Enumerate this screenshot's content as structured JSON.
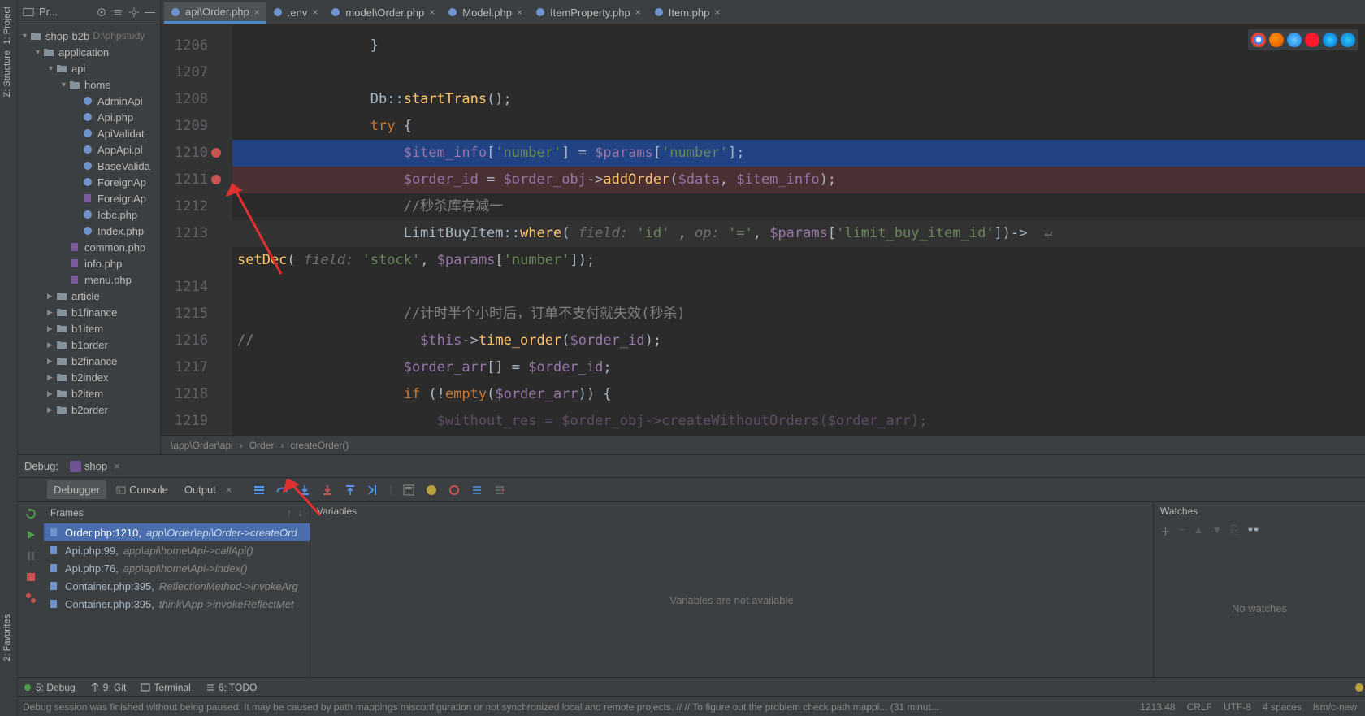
{
  "leftstrip": {
    "items": [
      "1: Project",
      "Z: Structure",
      "2: Favorites"
    ]
  },
  "project": {
    "head_label": "Pr...",
    "root": {
      "name": "shop-b2b",
      "path": "D:\\phpstudy"
    },
    "tree": [
      {
        "d": 0,
        "a": "o",
        "ic": "fd",
        "txt": "shop-b2b",
        "suffix": "D:\\phpstudy"
      },
      {
        "d": 1,
        "a": "o",
        "ic": "fd",
        "txt": "application"
      },
      {
        "d": 2,
        "a": "o",
        "ic": "fd",
        "txt": "api"
      },
      {
        "d": 3,
        "a": "o",
        "ic": "fd",
        "txt": "home"
      },
      {
        "d": 4,
        "a": "n",
        "ic": "php",
        "txt": "AdminApi"
      },
      {
        "d": 4,
        "a": "n",
        "ic": "php",
        "txt": "Api.php"
      },
      {
        "d": 4,
        "a": "n",
        "ic": "php",
        "txt": "ApiValidat"
      },
      {
        "d": 4,
        "a": "n",
        "ic": "php",
        "txt": "AppApi.pl"
      },
      {
        "d": 4,
        "a": "n",
        "ic": "php",
        "txt": "BaseValida"
      },
      {
        "d": 4,
        "a": "n",
        "ic": "php",
        "txt": "ForeignAp"
      },
      {
        "d": 4,
        "a": "n",
        "ic": "ptxt",
        "txt": "ForeignAp"
      },
      {
        "d": 4,
        "a": "n",
        "ic": "php",
        "txt": "Icbc.php"
      },
      {
        "d": 4,
        "a": "n",
        "ic": "php",
        "txt": "Index.php"
      },
      {
        "d": 3,
        "a": "n",
        "ic": "ptxt",
        "txt": "common.php"
      },
      {
        "d": 3,
        "a": "n",
        "ic": "ptxt",
        "txt": "info.php"
      },
      {
        "d": 3,
        "a": "n",
        "ic": "ptxt",
        "txt": "menu.php"
      },
      {
        "d": 2,
        "a": "c",
        "ic": "fd",
        "txt": "article"
      },
      {
        "d": 2,
        "a": "c",
        "ic": "fd",
        "txt": "b1finance"
      },
      {
        "d": 2,
        "a": "c",
        "ic": "fd",
        "txt": "b1item"
      },
      {
        "d": 2,
        "a": "c",
        "ic": "fd",
        "txt": "b1order"
      },
      {
        "d": 2,
        "a": "c",
        "ic": "fd",
        "txt": "b2finance"
      },
      {
        "d": 2,
        "a": "c",
        "ic": "fd",
        "txt": "b2index"
      },
      {
        "d": 2,
        "a": "c",
        "ic": "fd",
        "txt": "b2item"
      },
      {
        "d": 2,
        "a": "c",
        "ic": "fd",
        "txt": "b2order"
      }
    ]
  },
  "tabs": [
    {
      "label": "api\\Order.php",
      "active": true
    },
    {
      "label": ".env",
      "active": false
    },
    {
      "label": "model\\Order.php",
      "active": false
    },
    {
      "label": "Model.php",
      "active": false
    },
    {
      "label": "ItemProperty.php",
      "active": false
    },
    {
      "label": "Item.php",
      "active": false
    }
  ],
  "editor": {
    "first_line": 1206,
    "breakpoints": [
      1210,
      1211
    ],
    "highlight_blue": 1210,
    "highlight_red": 1211,
    "current_line": 1213,
    "code": [
      {
        "n": 1206,
        "html": "                }"
      },
      {
        "n": 1207,
        "html": ""
      },
      {
        "n": 1208,
        "html": "                Db::<span class='tok-f'>startTrans</span>();"
      },
      {
        "n": 1209,
        "html": "                <span class='tok-k'>try</span> {"
      },
      {
        "n": 1210,
        "html": "                    <span class='tok-v'>$item_info</span>[<span class='tok-s'>'number'</span>] = <span class='tok-v'>$params</span>[<span class='tok-s'>'number'</span>];"
      },
      {
        "n": 1211,
        "html": "                    <span class='tok-v'>$order_id</span> = <span class='tok-v'>$order_obj</span>-&gt;<span class='tok-f'>addOrder</span>(<span class='tok-v'>$data</span>, <span class='tok-v'>$item_info</span>);"
      },
      {
        "n": 1212,
        "html": "                    <span class='tok-c'>//秒杀库存减一</span>"
      },
      {
        "n": 1213,
        "html": "                    LimitBuyItem::<span class='tok-f'>where</span>( <span class='tok-hint'>field:</span> <span class='tok-s'>'id'</span> , <span class='tok-hint'>op:</span> <span class='tok-s'>'='</span>, <span class='tok-v'>$params</span>[<span class='tok-s'>'limit_buy_item_id'</span>])-&gt;  <span class='tok-hint'>↵</span>"
      },
      {
        "n": 0,
        "html": "<span class='tok-f'>setDec</span>( <span class='tok-hint'>field:</span> <span class='tok-s'>'stock'</span>, <span class='tok-v'>$params</span>[<span class='tok-s'>'number'</span>]);"
      },
      {
        "n": 1214,
        "html": ""
      },
      {
        "n": 1215,
        "html": "                    <span class='tok-c'>//计时半个小时后，订单不支付就失效(秒杀)</span>"
      },
      {
        "n": 1216,
        "html": "<span class='tok-c'>//</span>                    <span class='tok-v'>$this</span>-&gt;<span class='tok-f'>time_order</span>(<span class='tok-v'>$order_id</span>);"
      },
      {
        "n": 1217,
        "html": "                    <span class='tok-v'>$order_arr</span>[] = <span class='tok-v'>$order_id</span>;"
      },
      {
        "n": 1218,
        "html": "                    <span class='tok-k'>if</span> (!<span class='tok-k'>empty</span>(<span class='tok-v'>$order_arr</span>)) {"
      },
      {
        "n": 1219,
        "html": "                        <span class='tok-v' style='opacity:.45'>$without_res = $order_obj-&gt;createWithoutOrders($order_arr);</span>"
      }
    ],
    "crumbs": [
      "\\app\\Order\\api",
      "Order",
      "createOrder()"
    ]
  },
  "debug": {
    "title": "Debug:",
    "run_config": "shop",
    "tabs": [
      {
        "label": "Debugger",
        "active": true
      },
      {
        "label": "Console",
        "active": false,
        "icon": true
      },
      {
        "label": "Output",
        "active": false
      }
    ],
    "frames_title": "Frames",
    "frames": [
      {
        "file": "Order.php:1210",
        "ctx": "app\\Order\\api\\Order->createOrd",
        "sel": true
      },
      {
        "file": "Api.php:99",
        "ctx": "app\\api\\home\\Api->callApi()"
      },
      {
        "file": "Api.php:76",
        "ctx": "app\\api\\home\\Api->index()"
      },
      {
        "file": "Container.php:395",
        "ctx": "ReflectionMethod->invokeArg"
      },
      {
        "file": "Container.php:395",
        "ctx": "think\\App->invokeReflectMet"
      }
    ],
    "variables_title": "Variables",
    "variables_msg": "Variables are not available",
    "watches_title": "Watches",
    "watches_msg": "No watches"
  },
  "toolbar_bottom": [
    {
      "icon": "bug",
      "label": "5: Debug",
      "u": true
    },
    {
      "icon": "git",
      "label": "9: Git"
    },
    {
      "icon": "term",
      "label": "Terminal"
    },
    {
      "icon": "todo",
      "label": "6: TODO"
    }
  ],
  "status": {
    "msg": "Debug session was finished without being paused: It may be caused by path mappings misconfiguration or not synchronized local and remote projects. // // To figure out the problem check path mappi... (31 minut...",
    "right": [
      "1213:48",
      "CRLF",
      "UTF-8",
      "4 spaces",
      "lsm/c-new"
    ]
  },
  "browsers": [
    "chrome",
    "firefox",
    "safari",
    "opera",
    "ie",
    "edge"
  ]
}
